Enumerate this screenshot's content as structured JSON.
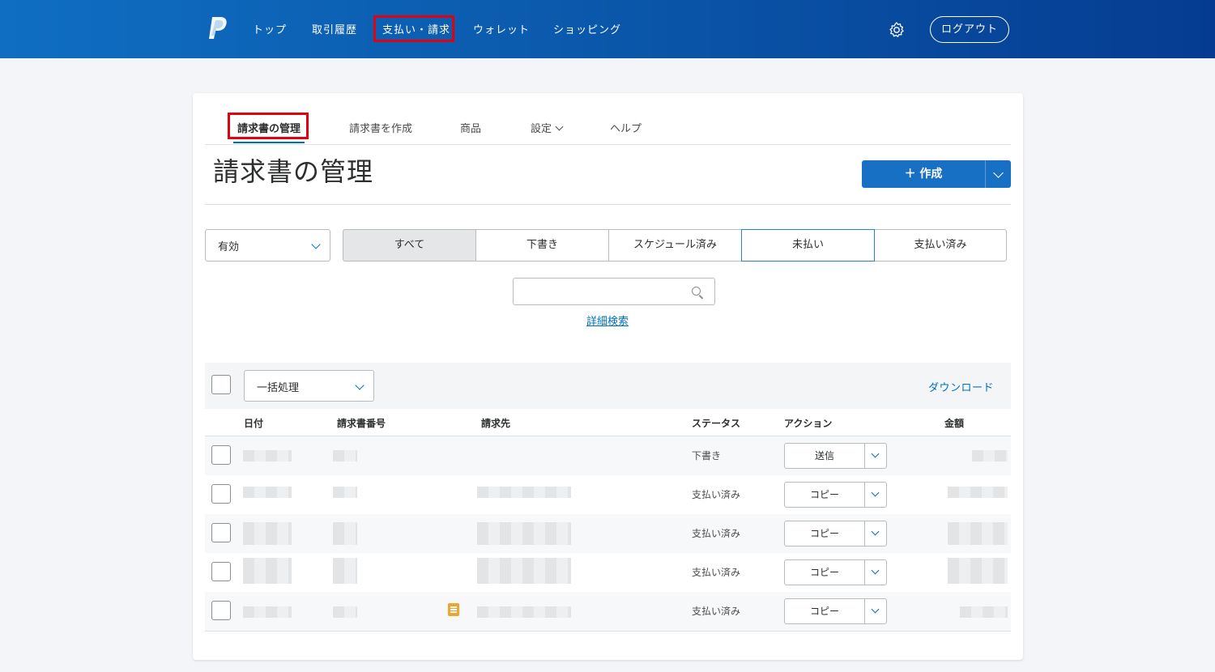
{
  "nav": {
    "items": [
      "トップ",
      "取引履歴",
      "支払い・請求",
      "ウォレット",
      "ショッピング"
    ],
    "logout_label": "ログアウト"
  },
  "tabs": [
    {
      "label": "請求書の管理",
      "active": true
    },
    {
      "label": "請求書を作成"
    },
    {
      "label": "商品"
    },
    {
      "label": "設定"
    },
    {
      "label": "ヘルプ"
    }
  ],
  "page_title": "請求書の管理",
  "create_button": "＋ 作成",
  "status_select": {
    "value": "有効"
  },
  "filters": [
    "すべて",
    "下書き",
    "スケジュール済み",
    "未払い",
    "支払い済み"
  ],
  "advanced_search": "詳細検索",
  "bulk_select": {
    "value": "一括処理"
  },
  "download_label": "ダウンロード",
  "table": {
    "headers": [
      "日付",
      "請求書番号",
      "請求先",
      "ステータス",
      "アクション",
      "金額"
    ],
    "rows": [
      {
        "status": "下書き",
        "action": "送信"
      },
      {
        "status": "支払い済み",
        "action": "コピー"
      },
      {
        "status": "支払い済み",
        "action": "コピー"
      },
      {
        "status": "支払い済み",
        "action": "コピー"
      },
      {
        "status": "支払い済み",
        "action": "コピー"
      }
    ]
  },
  "colors": {
    "brand": "#0b5aad",
    "accent": "#0070ba",
    "highlight": "#e3000f"
  }
}
